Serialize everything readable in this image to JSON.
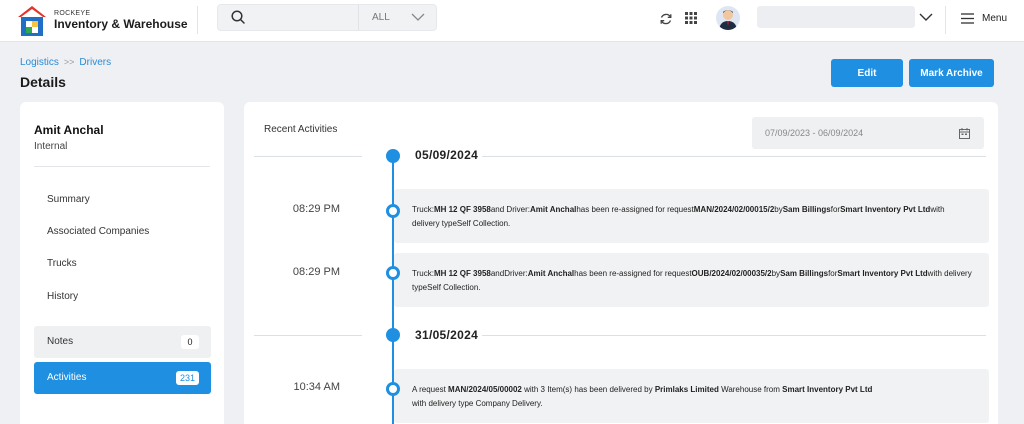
{
  "app": {
    "brand_small": "ROCKEYE",
    "brand_name": "Inventory & Warehouse"
  },
  "search": {
    "placeholder": "",
    "scope": "ALL"
  },
  "topbar": {
    "menu_label": "Menu"
  },
  "breadcrumb": {
    "items": [
      "Logistics",
      "Drivers"
    ]
  },
  "page": {
    "title": "Details",
    "edit_label": "Edit",
    "archive_label": "Mark Archive"
  },
  "driver": {
    "name": "Amit Anchal",
    "type": "Internal"
  },
  "nav": {
    "items": [
      "Summary",
      "Associated Companies",
      "Trucks",
      "History"
    ],
    "notes": {
      "label": "Notes",
      "count": "0"
    },
    "activities": {
      "label": "Activities",
      "count": "231"
    }
  },
  "activities": {
    "title": "Recent Activities",
    "date_range": "07/09/2023 - 06/09/2024",
    "groups": [
      {
        "date": "05/09/2024",
        "events": [
          {
            "time": "08:29 PM",
            "t1": "Truck:",
            "truck": "MH 12 QF 3958",
            "t2": "and Driver:",
            "driver": "Amit Anchal",
            "t3": "has been re-assigned for request",
            "request": "MAN/2024/02/00015/2",
            "t4": "by",
            "by": "Sam Billings",
            "t5": "for",
            "company": "Smart Inventory Pvt Ltd",
            "t6": "with delivery type",
            "delivery": "Self Collection."
          },
          {
            "time": "08:29 PM",
            "t1": "Truck:",
            "truck": "MH 12 QF 3958",
            "t2": "andDriver:",
            "driver": "Amit Anchal",
            "t3": "has been re-assigned for request",
            "request": "OUB/2024/02/00035/2",
            "t4": "by",
            "by": "Sam Billings",
            "t5": "for",
            "company": "Smart Inventory Pvt Ltd",
            "t6": "with delivery type",
            "delivery": "Self Collection."
          }
        ]
      },
      {
        "date": "31/05/2024",
        "events": [
          {
            "time": "10:34 AM",
            "t1": "A request ",
            "request": "MAN/2024/05/00002",
            "t2": " with 3 Item(s) has been delivered by ",
            "by": "Primlaks Limited",
            "t3": " Warehouse from ",
            "company": "Smart Inventory Pvt Ltd",
            "t4": "with delivery type Company Delivery."
          }
        ]
      }
    ]
  },
  "colors": {
    "accent": "#1e8fe1",
    "page_bg": "#eef0f3",
    "event_bg": "#f1f2f4"
  }
}
